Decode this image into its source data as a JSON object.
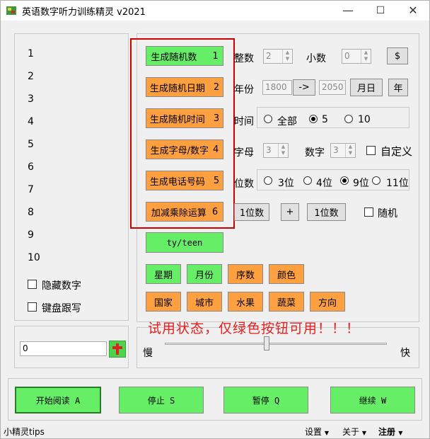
{
  "title": "英语数字听力训练精灵 v2021",
  "window_controls": {
    "minimize": "—",
    "maximize": "☐",
    "close": "✕"
  },
  "numbers": [
    "1",
    "2",
    "3",
    "4",
    "5",
    "6",
    "7",
    "8",
    "9",
    "10"
  ],
  "hide_numbers_label": "隐藏数字",
  "keyboard_follow_label": "键盘跟写",
  "input_value": "0",
  "generators": [
    {
      "label": "生成随机数",
      "key": "1"
    },
    {
      "label": "生成随机日期",
      "key": "2"
    },
    {
      "label": "生成随机时间",
      "key": "3"
    },
    {
      "label": "生成字母/数字",
      "key": "4"
    },
    {
      "label": "生成电话号码",
      "key": "5"
    },
    {
      "label": "加减乘除运算",
      "key": "6"
    }
  ],
  "integer_label": "整数",
  "integer_value": "2",
  "decimal_label": "小数",
  "decimal_value": "0",
  "dollar_label": "$",
  "year_label": "年份",
  "year_from": "1800",
  "arrow_label": "->",
  "year_to": "2050",
  "month_day_label": "月日",
  "year_btn_label": "年",
  "time_label": "时间",
  "time_all": "全部",
  "time_5": "5",
  "time_10": "10",
  "letters_label": "字母",
  "letters_value": "3",
  "digits_label": "数字",
  "digits_value": "3",
  "custom_label": "自定义",
  "digits_count_label": "位数",
  "d3": "3位",
  "d4": "4位",
  "d9": "9位",
  "d11": "11位",
  "operand1_label": "1位数",
  "operator_label": "+",
  "operand2_label": "1位数",
  "random_label": "随机",
  "tyteen_label": "ty/teen",
  "row1": [
    "星期",
    "月份",
    "序数",
    "颜色"
  ],
  "row2": [
    "国家",
    "城市",
    "水果",
    "蔬菜",
    "方向"
  ],
  "notice": "试用状态，仅绿色按钮可用！！！",
  "slow_label": "慢",
  "fast_label": "快",
  "start_label": "开始阅读 A",
  "stop_label": "停止 S",
  "pause_label": "暂停 Q",
  "continue_label": "继续 W",
  "tips_label": "小精灵tips",
  "menu_settings": "设置",
  "menu_about": "关于",
  "menu_register": "注册",
  "colors": {
    "green": "#66ee66",
    "orange": "#ffa040",
    "red": "#e82020"
  }
}
